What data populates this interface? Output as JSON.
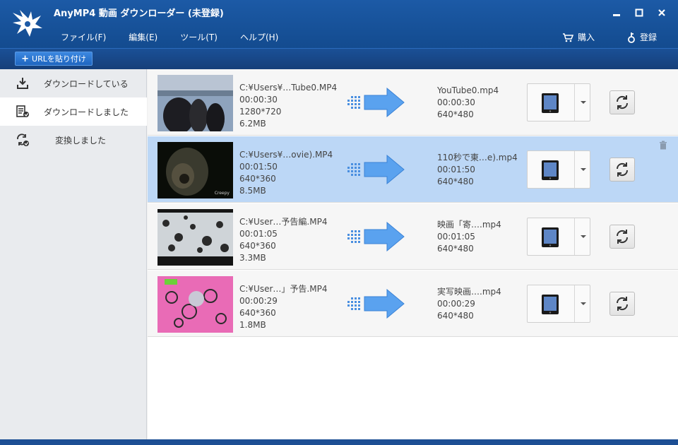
{
  "app": {
    "title": "AnyMP4 動画 ダウンローダー (未登録)"
  },
  "menu": [
    {
      "label": "ファイル(F)"
    },
    {
      "label": "編集(E)"
    },
    {
      "label": "ツール(T)"
    },
    {
      "label": "ヘルプ(H)"
    }
  ],
  "header_actions": {
    "buy_label": "購入",
    "register_label": "登録"
  },
  "toolbar": {
    "paste_url_label": "URLを貼り付け"
  },
  "sidebar": {
    "items": [
      {
        "label": "ダウンロードしている",
        "icon": "download-icon"
      },
      {
        "label": "ダウンロードしました",
        "icon": "downloaded-list-icon"
      },
      {
        "label": "変換しました",
        "icon": "converted-icon"
      }
    ],
    "active_index": 1
  },
  "rows": [
    {
      "source_path": "C:¥Users¥…Tube0.MP4",
      "source_duration": "00:00:30",
      "source_resolution": "1280*720",
      "source_size": "6.2MB",
      "output_name": "YouTube0.mp4",
      "output_duration": "00:00:30",
      "output_resolution": "640*480",
      "thumb": "harbor-scene"
    },
    {
      "source_path": "C:¥Users¥…ovie).MP4",
      "source_duration": "00:01:50",
      "source_resolution": "640*360",
      "source_size": "8.5MB",
      "output_name": "110秒で東…e).mp4",
      "output_duration": "00:01:50",
      "output_resolution": "640*480",
      "thumb": "dark-scene",
      "thumb_caption": "Creepy"
    },
    {
      "source_path": "C:¥User…予告編.MP4",
      "source_duration": "00:01:05",
      "source_resolution": "640*360",
      "source_size": "3.3MB",
      "output_name": "映画「寄….mp4",
      "output_duration": "00:01:05",
      "output_resolution": "640*480",
      "thumb": "snow-scene"
    },
    {
      "source_path": "C:¥User…」予告.MP4",
      "source_duration": "00:00:29",
      "source_resolution": "640*360",
      "source_size": "1.8MB",
      "output_name": "実写映画….mp4",
      "output_duration": "00:00:29",
      "output_resolution": "640*480",
      "thumb": "pink-scene"
    }
  ],
  "selected_row": 1,
  "colors": {
    "title_bar": "#1c5aa6",
    "selected_row": "#bcd7f6",
    "arrow": "#5aa2ef"
  }
}
